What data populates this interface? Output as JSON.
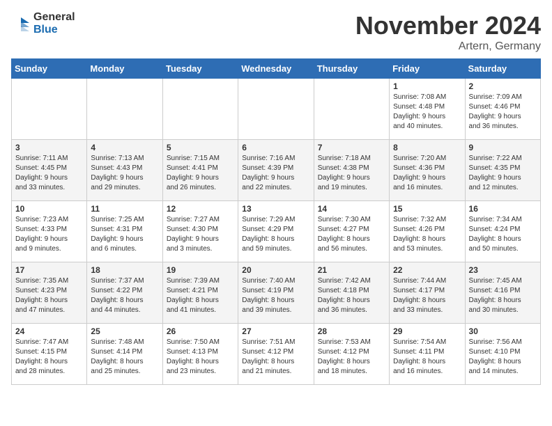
{
  "logo": {
    "general": "General",
    "blue": "Blue"
  },
  "header": {
    "month": "November 2024",
    "location": "Artern, Germany"
  },
  "weekdays": [
    "Sunday",
    "Monday",
    "Tuesday",
    "Wednesday",
    "Thursday",
    "Friday",
    "Saturday"
  ],
  "weeks": [
    [
      {
        "day": "",
        "info": ""
      },
      {
        "day": "",
        "info": ""
      },
      {
        "day": "",
        "info": ""
      },
      {
        "day": "",
        "info": ""
      },
      {
        "day": "",
        "info": ""
      },
      {
        "day": "1",
        "info": "Sunrise: 7:08 AM\nSunset: 4:48 PM\nDaylight: 9 hours\nand 40 minutes."
      },
      {
        "day": "2",
        "info": "Sunrise: 7:09 AM\nSunset: 4:46 PM\nDaylight: 9 hours\nand 36 minutes."
      }
    ],
    [
      {
        "day": "3",
        "info": "Sunrise: 7:11 AM\nSunset: 4:45 PM\nDaylight: 9 hours\nand 33 minutes."
      },
      {
        "day": "4",
        "info": "Sunrise: 7:13 AM\nSunset: 4:43 PM\nDaylight: 9 hours\nand 29 minutes."
      },
      {
        "day": "5",
        "info": "Sunrise: 7:15 AM\nSunset: 4:41 PM\nDaylight: 9 hours\nand 26 minutes."
      },
      {
        "day": "6",
        "info": "Sunrise: 7:16 AM\nSunset: 4:39 PM\nDaylight: 9 hours\nand 22 minutes."
      },
      {
        "day": "7",
        "info": "Sunrise: 7:18 AM\nSunset: 4:38 PM\nDaylight: 9 hours\nand 19 minutes."
      },
      {
        "day": "8",
        "info": "Sunrise: 7:20 AM\nSunset: 4:36 PM\nDaylight: 9 hours\nand 16 minutes."
      },
      {
        "day": "9",
        "info": "Sunrise: 7:22 AM\nSunset: 4:35 PM\nDaylight: 9 hours\nand 12 minutes."
      }
    ],
    [
      {
        "day": "10",
        "info": "Sunrise: 7:23 AM\nSunset: 4:33 PM\nDaylight: 9 hours\nand 9 minutes."
      },
      {
        "day": "11",
        "info": "Sunrise: 7:25 AM\nSunset: 4:31 PM\nDaylight: 9 hours\nand 6 minutes."
      },
      {
        "day": "12",
        "info": "Sunrise: 7:27 AM\nSunset: 4:30 PM\nDaylight: 9 hours\nand 3 minutes."
      },
      {
        "day": "13",
        "info": "Sunrise: 7:29 AM\nSunset: 4:29 PM\nDaylight: 8 hours\nand 59 minutes."
      },
      {
        "day": "14",
        "info": "Sunrise: 7:30 AM\nSunset: 4:27 PM\nDaylight: 8 hours\nand 56 minutes."
      },
      {
        "day": "15",
        "info": "Sunrise: 7:32 AM\nSunset: 4:26 PM\nDaylight: 8 hours\nand 53 minutes."
      },
      {
        "day": "16",
        "info": "Sunrise: 7:34 AM\nSunset: 4:24 PM\nDaylight: 8 hours\nand 50 minutes."
      }
    ],
    [
      {
        "day": "17",
        "info": "Sunrise: 7:35 AM\nSunset: 4:23 PM\nDaylight: 8 hours\nand 47 minutes."
      },
      {
        "day": "18",
        "info": "Sunrise: 7:37 AM\nSunset: 4:22 PM\nDaylight: 8 hours\nand 44 minutes."
      },
      {
        "day": "19",
        "info": "Sunrise: 7:39 AM\nSunset: 4:21 PM\nDaylight: 8 hours\nand 41 minutes."
      },
      {
        "day": "20",
        "info": "Sunrise: 7:40 AM\nSunset: 4:19 PM\nDaylight: 8 hours\nand 39 minutes."
      },
      {
        "day": "21",
        "info": "Sunrise: 7:42 AM\nSunset: 4:18 PM\nDaylight: 8 hours\nand 36 minutes."
      },
      {
        "day": "22",
        "info": "Sunrise: 7:44 AM\nSunset: 4:17 PM\nDaylight: 8 hours\nand 33 minutes."
      },
      {
        "day": "23",
        "info": "Sunrise: 7:45 AM\nSunset: 4:16 PM\nDaylight: 8 hours\nand 30 minutes."
      }
    ],
    [
      {
        "day": "24",
        "info": "Sunrise: 7:47 AM\nSunset: 4:15 PM\nDaylight: 8 hours\nand 28 minutes."
      },
      {
        "day": "25",
        "info": "Sunrise: 7:48 AM\nSunset: 4:14 PM\nDaylight: 8 hours\nand 25 minutes."
      },
      {
        "day": "26",
        "info": "Sunrise: 7:50 AM\nSunset: 4:13 PM\nDaylight: 8 hours\nand 23 minutes."
      },
      {
        "day": "27",
        "info": "Sunrise: 7:51 AM\nSunset: 4:12 PM\nDaylight: 8 hours\nand 21 minutes."
      },
      {
        "day": "28",
        "info": "Sunrise: 7:53 AM\nSunset: 4:12 PM\nDaylight: 8 hours\nand 18 minutes."
      },
      {
        "day": "29",
        "info": "Sunrise: 7:54 AM\nSunset: 4:11 PM\nDaylight: 8 hours\nand 16 minutes."
      },
      {
        "day": "30",
        "info": "Sunrise: 7:56 AM\nSunset: 4:10 PM\nDaylight: 8 hours\nand 14 minutes."
      }
    ]
  ]
}
